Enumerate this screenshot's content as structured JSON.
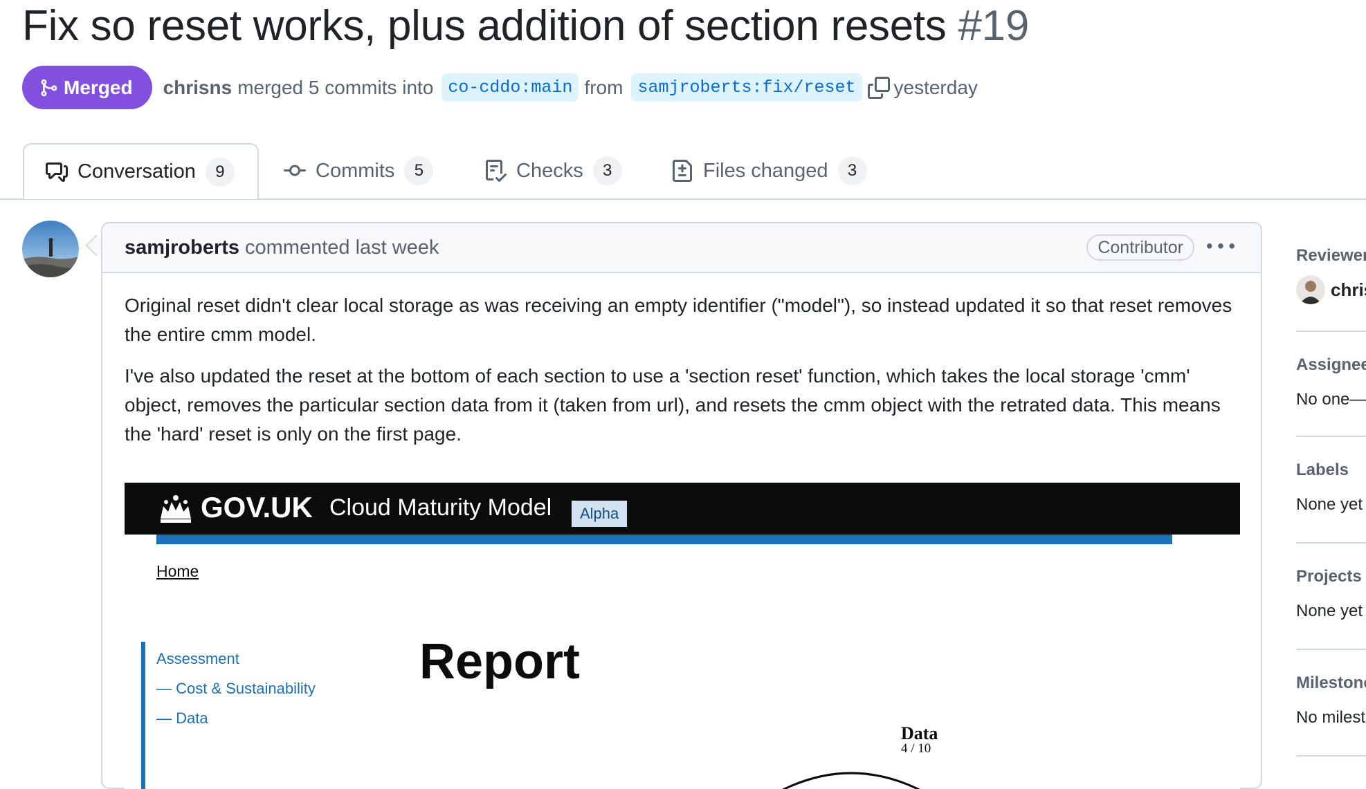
{
  "title": {
    "text": "Fix so reset works, plus addition of section resets",
    "number": "#19"
  },
  "meta": {
    "state": "Merged",
    "author": "chrisns",
    "action": "merged 5 commits into",
    "base_branch": "co-cddo:main",
    "from_label": "from",
    "head_branch": "samjroberts:fix/reset",
    "time": "yesterday"
  },
  "tabs": [
    {
      "label": "Conversation",
      "count": "9",
      "icon": "comment-discussion-icon"
    },
    {
      "label": "Commits",
      "count": "5",
      "icon": "git-commit-icon"
    },
    {
      "label": "Checks",
      "count": "3",
      "icon": "checklist-icon"
    },
    {
      "label": "Files changed",
      "count": "3",
      "icon": "file-diff-icon"
    }
  ],
  "comment": {
    "author": "samjroberts",
    "action": "commented last week",
    "role": "Contributor",
    "paragraphs": [
      "Original reset didn't clear local storage as was receiving an empty identifier (\"model\"), so instead updated it so that reset removes the entire cmm model.",
      "I've also updated the reset at the bottom of each section to use a 'section reset' function, which takes the local storage 'cmm' object, removes the particular section data from it (taken from url), and resets the cmm object with the retrated data. This means the 'hard' reset is only on the first page."
    ],
    "screenshot": {
      "logo": "GOV.UK",
      "service": "Cloud Maturity Model",
      "tag": "Alpha",
      "breadcrumb": "Home",
      "nav": [
        "Assessment",
        "— Cost & Sustainability",
        "— Data"
      ],
      "heading": "Report",
      "chart_label": "Data",
      "chart_score": "4 / 10"
    }
  },
  "sidebar": {
    "reviewers": {
      "title": "Reviewers",
      "value": "chrisns"
    },
    "assignees": {
      "title": "Assignees",
      "value": "No one—"
    },
    "labels": {
      "title": "Labels",
      "value": "None yet"
    },
    "projects": {
      "title": "Projects",
      "value": "None yet"
    },
    "milestone": {
      "title": "Milestone",
      "value": "No milestone"
    }
  },
  "colors": {
    "merged": "#8250df",
    "branch_bg": "#ddf4ff",
    "branch_fg": "#0969da",
    "gov_black": "#0b0c0c",
    "gov_blue": "#1d70b8"
  }
}
